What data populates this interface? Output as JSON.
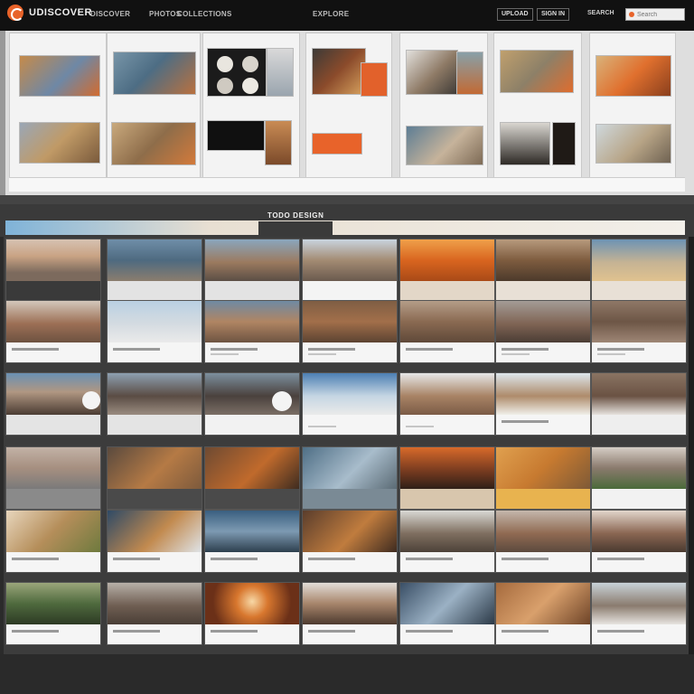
{
  "header": {
    "app_title": "UDISCOVER",
    "logo_icon": "orange-ring-logo",
    "nav": [
      "DISCOVER",
      "PHOTOS",
      "COLLECTIONS",
      "EXPLORE"
    ],
    "pills": [
      "UPLOAD",
      "SIGN IN",
      "SEARCH"
    ],
    "search_placeholder": "Search"
  },
  "section": {
    "title": "TODO DESIGN"
  },
  "colors": {
    "accent": "#e8632a",
    "topbar": "#111111",
    "grid_bg": "#3c3c3c"
  }
}
